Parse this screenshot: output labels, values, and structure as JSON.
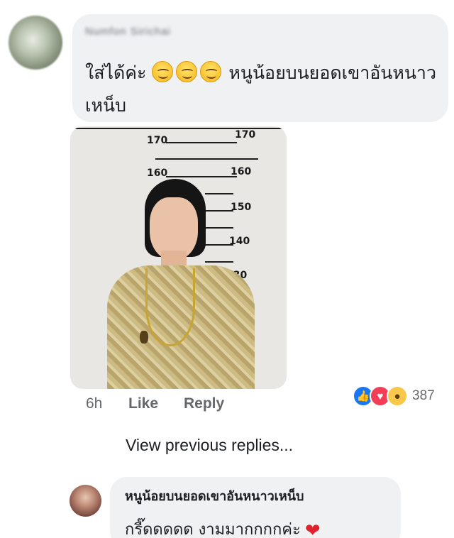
{
  "comment1": {
    "author": "Numfon Sirichai",
    "text_before_emoji": "ใส่ได้ค่ะ",
    "emojis": [
      "smiling-face-icon",
      "smiling-face-icon",
      "smiling-face-icon"
    ],
    "text_after_emoji": "หนูน้อยบนยอดเขาอันหนาวเหน็บ",
    "photo": {
      "height_markers": [
        "170",
        "170",
        "160",
        "160",
        "150",
        "140",
        "130"
      ]
    },
    "time": "6h",
    "like_label": "Like",
    "reply_label": "Reply",
    "reactions": [
      "like-reaction-icon",
      "love-reaction-icon",
      "wow-reaction-icon"
    ],
    "reaction_count": "387"
  },
  "view_previous_replies": "View previous replies...",
  "reply1": {
    "author": "หนูน้อยบนยอดเขาอันหนาวเหน็บ",
    "text": "กรี๊ดดดดด งามมากกกกค่ะ",
    "emoji": "heart-icon"
  }
}
